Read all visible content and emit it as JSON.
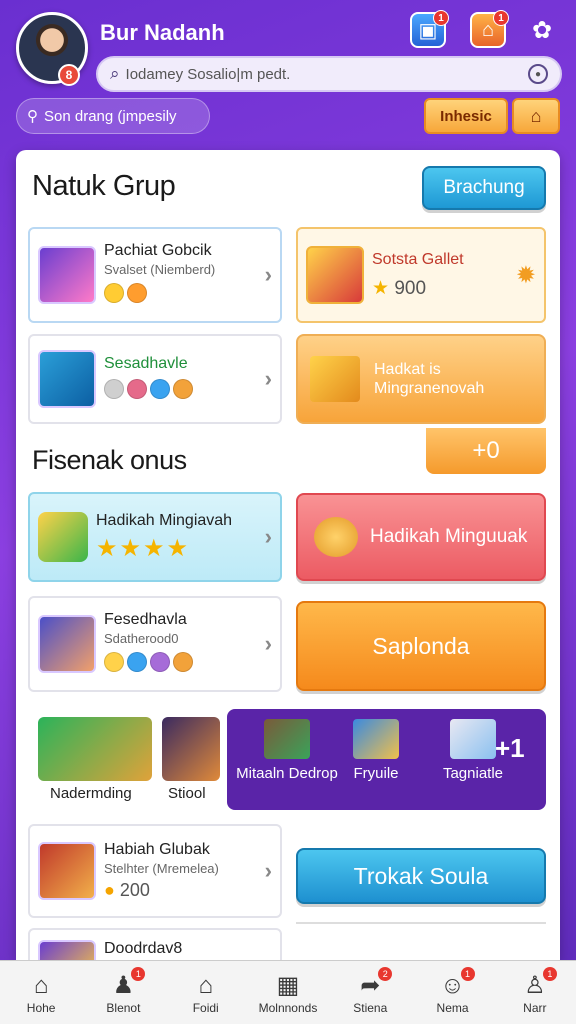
{
  "header": {
    "username": "Bur Nadanh",
    "avatar_badge": "8",
    "icon_badge_1": "1",
    "icon_badge_2": "1",
    "search_placeholder": "Iodamey Sosalio|m pedt.",
    "sub_search": "Son drang (jmpesily",
    "top_button": "Inhesic"
  },
  "section1": {
    "title": "Natuk Grup",
    "action_button": "Brachung",
    "card1": {
      "title": "Pachiat Gobcik",
      "subtitle": "Svalset (Niemberd)"
    },
    "card2": {
      "title": "Sesadhavle"
    },
    "reward_card": {
      "title": "Sotsta Gallet",
      "value": "900"
    },
    "orange_card": {
      "line1": "Hadkat is",
      "line2": "Mingranenovah"
    },
    "plus_value": "+0"
  },
  "section2": {
    "title": "Fisenak onus",
    "card3": {
      "title": "Hadikah Mingiavah"
    },
    "red_button": "Hadikah Minguuak",
    "card4": {
      "title": "Fesedhavla",
      "subtitle": "Sdatherood0"
    },
    "orange_button": "Saplonda"
  },
  "strip": {
    "left_label1": "Nadermding",
    "left_label2": "Stiool",
    "items": [
      "Mitaaln Dedrop",
      "Fryuile",
      "Tagniatle"
    ],
    "plus": "+1"
  },
  "section3": {
    "card5": {
      "title": "Habiah Glubak",
      "subtitle": "Stelhter (Mremelea)",
      "value": "200"
    },
    "blue_button": "Trokak Soula",
    "card6": {
      "title": "Doodrdav8"
    }
  },
  "nav": [
    {
      "label": "Hohe",
      "icon": "home-icon",
      "badge": ""
    },
    {
      "label": "Blenot",
      "icon": "users-icon",
      "badge": "1"
    },
    {
      "label": "Foidi",
      "icon": "house-icon",
      "badge": ""
    },
    {
      "label": "Molnnonds",
      "icon": "grid-icon",
      "badge": ""
    },
    {
      "label": "Stiena",
      "icon": "share-icon",
      "badge": "2"
    },
    {
      "label": "Nema",
      "icon": "profile-icon",
      "badge": "1"
    },
    {
      "label": "Narr",
      "icon": "user-icon",
      "badge": "1"
    }
  ],
  "colors": {
    "brand_purple": "#6a2fd0",
    "accent_orange": "#f7a73a",
    "accent_blue": "#29a9e0",
    "accent_red": "#f0636a"
  }
}
